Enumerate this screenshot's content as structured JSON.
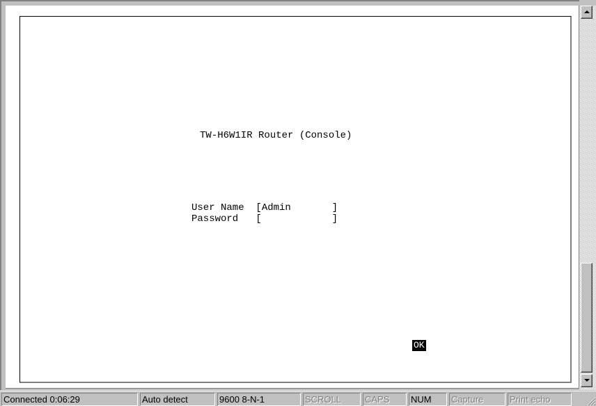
{
  "terminal": {
    "title_line": "TW-H6W1IR Router (Console)",
    "username_line": "User Name  [Admin       ]",
    "password_line": "Password   [            ]",
    "ok_label": "OK"
  },
  "statusbar": {
    "connected": "Connected 0:06:29",
    "detect": "Auto detect",
    "port": "9600 8-N-1",
    "scroll": "SCROLL",
    "caps": "CAPS",
    "num": "NUM",
    "capture": "Capture",
    "print_echo": "Print echo"
  },
  "colors": {
    "window_bg": "#c0c0c0",
    "screen_bg": "#ffffff",
    "highlight_bg": "#000000"
  },
  "icons": {
    "scroll_up": "up-arrow-icon",
    "scroll_down": "down-arrow-icon",
    "resize_grip": "resize-grip-icon"
  }
}
